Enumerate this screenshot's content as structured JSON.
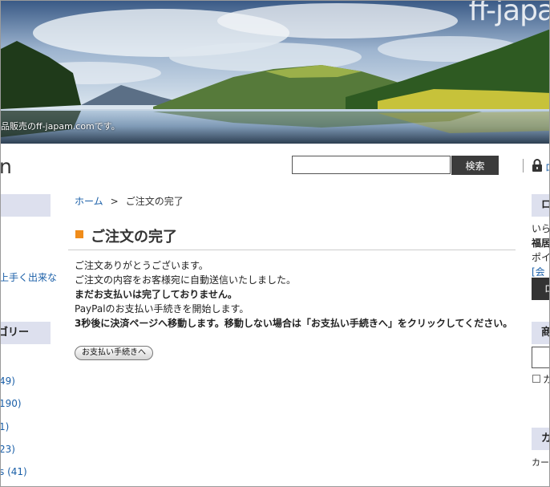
{
  "header": {
    "logo_text": "ff-japa",
    "tagline": "品販売のff-japam.comです。",
    "site_initial": "n"
  },
  "search": {
    "value": "",
    "button_label": "検索"
  },
  "top_links": {
    "login_partial": "ロ"
  },
  "left_sidebar": {
    "section1_partial": "",
    "link_partial": "上手く出来な",
    "category_head_partial": "ゴリー",
    "category_counts": [
      "49)",
      "190)",
      "1)",
      "23)",
      "s (41)"
    ]
  },
  "breadcrumb": {
    "home": "ホーム",
    "separator": ">",
    "current": "ご注文の完了"
  },
  "main": {
    "title": "ご注文の完了",
    "lines": [
      "ご注文ありがとうございます。",
      "ご注文の内容をお客様宛に自動送信いたしました。",
      "まだお支払いは完了しておりません。",
      "PayPalのお支払い手続きを開始します。",
      "3秒後に決済ページへ移動します。移動しない場合は「お支払い手続きへ」をクリックしてください。"
    ],
    "pay_button": "お支払い手続きへ"
  },
  "right_sidebar": {
    "head1_partial": "ロ",
    "text1": "いら",
    "text2": "福居",
    "text3": "ポイ",
    "link1": "[会",
    "dark_button_partial": "ロ",
    "head2_partial": "商",
    "checkbox_label_partial": "カ",
    "head3_partial": "カ",
    "text4": "カー"
  },
  "colors": {
    "accent": "#f08c1a",
    "link": "#1a5fa8",
    "sidebar_head": "#dde0ee",
    "search_button": "#3b3b3b"
  }
}
